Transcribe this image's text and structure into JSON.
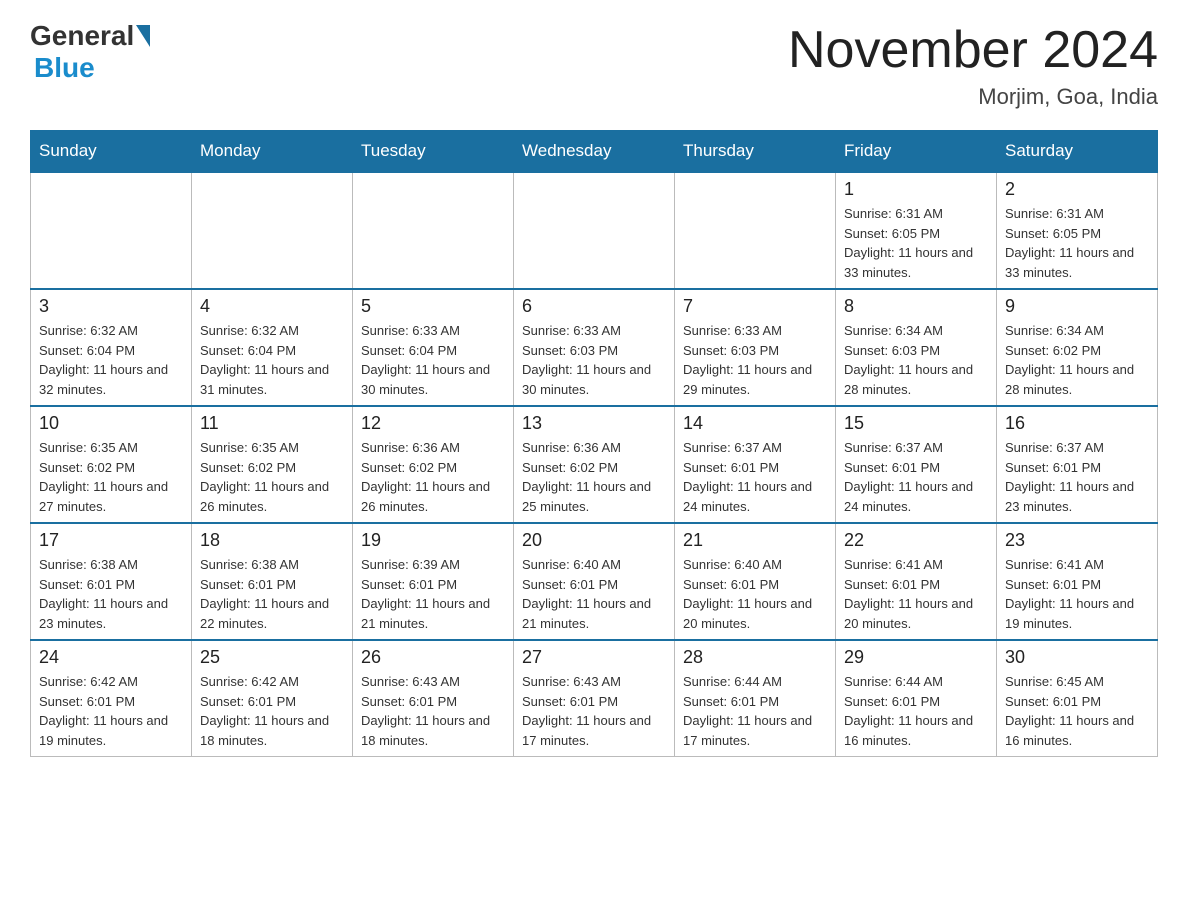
{
  "header": {
    "logo_text": "General",
    "logo_blue": "Blue",
    "month_title": "November 2024",
    "location": "Morjim, Goa, India"
  },
  "weekdays": [
    "Sunday",
    "Monday",
    "Tuesday",
    "Wednesday",
    "Thursday",
    "Friday",
    "Saturday"
  ],
  "weeks": [
    [
      {
        "day": "",
        "sunrise": "",
        "sunset": "",
        "daylight": ""
      },
      {
        "day": "",
        "sunrise": "",
        "sunset": "",
        "daylight": ""
      },
      {
        "day": "",
        "sunrise": "",
        "sunset": "",
        "daylight": ""
      },
      {
        "day": "",
        "sunrise": "",
        "sunset": "",
        "daylight": ""
      },
      {
        "day": "",
        "sunrise": "",
        "sunset": "",
        "daylight": ""
      },
      {
        "day": "1",
        "sunrise": "Sunrise: 6:31 AM",
        "sunset": "Sunset: 6:05 PM",
        "daylight": "Daylight: 11 hours and 33 minutes."
      },
      {
        "day": "2",
        "sunrise": "Sunrise: 6:31 AM",
        "sunset": "Sunset: 6:05 PM",
        "daylight": "Daylight: 11 hours and 33 minutes."
      }
    ],
    [
      {
        "day": "3",
        "sunrise": "Sunrise: 6:32 AM",
        "sunset": "Sunset: 6:04 PM",
        "daylight": "Daylight: 11 hours and 32 minutes."
      },
      {
        "day": "4",
        "sunrise": "Sunrise: 6:32 AM",
        "sunset": "Sunset: 6:04 PM",
        "daylight": "Daylight: 11 hours and 31 minutes."
      },
      {
        "day": "5",
        "sunrise": "Sunrise: 6:33 AM",
        "sunset": "Sunset: 6:04 PM",
        "daylight": "Daylight: 11 hours and 30 minutes."
      },
      {
        "day": "6",
        "sunrise": "Sunrise: 6:33 AM",
        "sunset": "Sunset: 6:03 PM",
        "daylight": "Daylight: 11 hours and 30 minutes."
      },
      {
        "day": "7",
        "sunrise": "Sunrise: 6:33 AM",
        "sunset": "Sunset: 6:03 PM",
        "daylight": "Daylight: 11 hours and 29 minutes."
      },
      {
        "day": "8",
        "sunrise": "Sunrise: 6:34 AM",
        "sunset": "Sunset: 6:03 PM",
        "daylight": "Daylight: 11 hours and 28 minutes."
      },
      {
        "day": "9",
        "sunrise": "Sunrise: 6:34 AM",
        "sunset": "Sunset: 6:02 PM",
        "daylight": "Daylight: 11 hours and 28 minutes."
      }
    ],
    [
      {
        "day": "10",
        "sunrise": "Sunrise: 6:35 AM",
        "sunset": "Sunset: 6:02 PM",
        "daylight": "Daylight: 11 hours and 27 minutes."
      },
      {
        "day": "11",
        "sunrise": "Sunrise: 6:35 AM",
        "sunset": "Sunset: 6:02 PM",
        "daylight": "Daylight: 11 hours and 26 minutes."
      },
      {
        "day": "12",
        "sunrise": "Sunrise: 6:36 AM",
        "sunset": "Sunset: 6:02 PM",
        "daylight": "Daylight: 11 hours and 26 minutes."
      },
      {
        "day": "13",
        "sunrise": "Sunrise: 6:36 AM",
        "sunset": "Sunset: 6:02 PM",
        "daylight": "Daylight: 11 hours and 25 minutes."
      },
      {
        "day": "14",
        "sunrise": "Sunrise: 6:37 AM",
        "sunset": "Sunset: 6:01 PM",
        "daylight": "Daylight: 11 hours and 24 minutes."
      },
      {
        "day": "15",
        "sunrise": "Sunrise: 6:37 AM",
        "sunset": "Sunset: 6:01 PM",
        "daylight": "Daylight: 11 hours and 24 minutes."
      },
      {
        "day": "16",
        "sunrise": "Sunrise: 6:37 AM",
        "sunset": "Sunset: 6:01 PM",
        "daylight": "Daylight: 11 hours and 23 minutes."
      }
    ],
    [
      {
        "day": "17",
        "sunrise": "Sunrise: 6:38 AM",
        "sunset": "Sunset: 6:01 PM",
        "daylight": "Daylight: 11 hours and 23 minutes."
      },
      {
        "day": "18",
        "sunrise": "Sunrise: 6:38 AM",
        "sunset": "Sunset: 6:01 PM",
        "daylight": "Daylight: 11 hours and 22 minutes."
      },
      {
        "day": "19",
        "sunrise": "Sunrise: 6:39 AM",
        "sunset": "Sunset: 6:01 PM",
        "daylight": "Daylight: 11 hours and 21 minutes."
      },
      {
        "day": "20",
        "sunrise": "Sunrise: 6:40 AM",
        "sunset": "Sunset: 6:01 PM",
        "daylight": "Daylight: 11 hours and 21 minutes."
      },
      {
        "day": "21",
        "sunrise": "Sunrise: 6:40 AM",
        "sunset": "Sunset: 6:01 PM",
        "daylight": "Daylight: 11 hours and 20 minutes."
      },
      {
        "day": "22",
        "sunrise": "Sunrise: 6:41 AM",
        "sunset": "Sunset: 6:01 PM",
        "daylight": "Daylight: 11 hours and 20 minutes."
      },
      {
        "day": "23",
        "sunrise": "Sunrise: 6:41 AM",
        "sunset": "Sunset: 6:01 PM",
        "daylight": "Daylight: 11 hours and 19 minutes."
      }
    ],
    [
      {
        "day": "24",
        "sunrise": "Sunrise: 6:42 AM",
        "sunset": "Sunset: 6:01 PM",
        "daylight": "Daylight: 11 hours and 19 minutes."
      },
      {
        "day": "25",
        "sunrise": "Sunrise: 6:42 AM",
        "sunset": "Sunset: 6:01 PM",
        "daylight": "Daylight: 11 hours and 18 minutes."
      },
      {
        "day": "26",
        "sunrise": "Sunrise: 6:43 AM",
        "sunset": "Sunset: 6:01 PM",
        "daylight": "Daylight: 11 hours and 18 minutes."
      },
      {
        "day": "27",
        "sunrise": "Sunrise: 6:43 AM",
        "sunset": "Sunset: 6:01 PM",
        "daylight": "Daylight: 11 hours and 17 minutes."
      },
      {
        "day": "28",
        "sunrise": "Sunrise: 6:44 AM",
        "sunset": "Sunset: 6:01 PM",
        "daylight": "Daylight: 11 hours and 17 minutes."
      },
      {
        "day": "29",
        "sunrise": "Sunrise: 6:44 AM",
        "sunset": "Sunset: 6:01 PM",
        "daylight": "Daylight: 11 hours and 16 minutes."
      },
      {
        "day": "30",
        "sunrise": "Sunrise: 6:45 AM",
        "sunset": "Sunset: 6:01 PM",
        "daylight": "Daylight: 11 hours and 16 minutes."
      }
    ]
  ]
}
